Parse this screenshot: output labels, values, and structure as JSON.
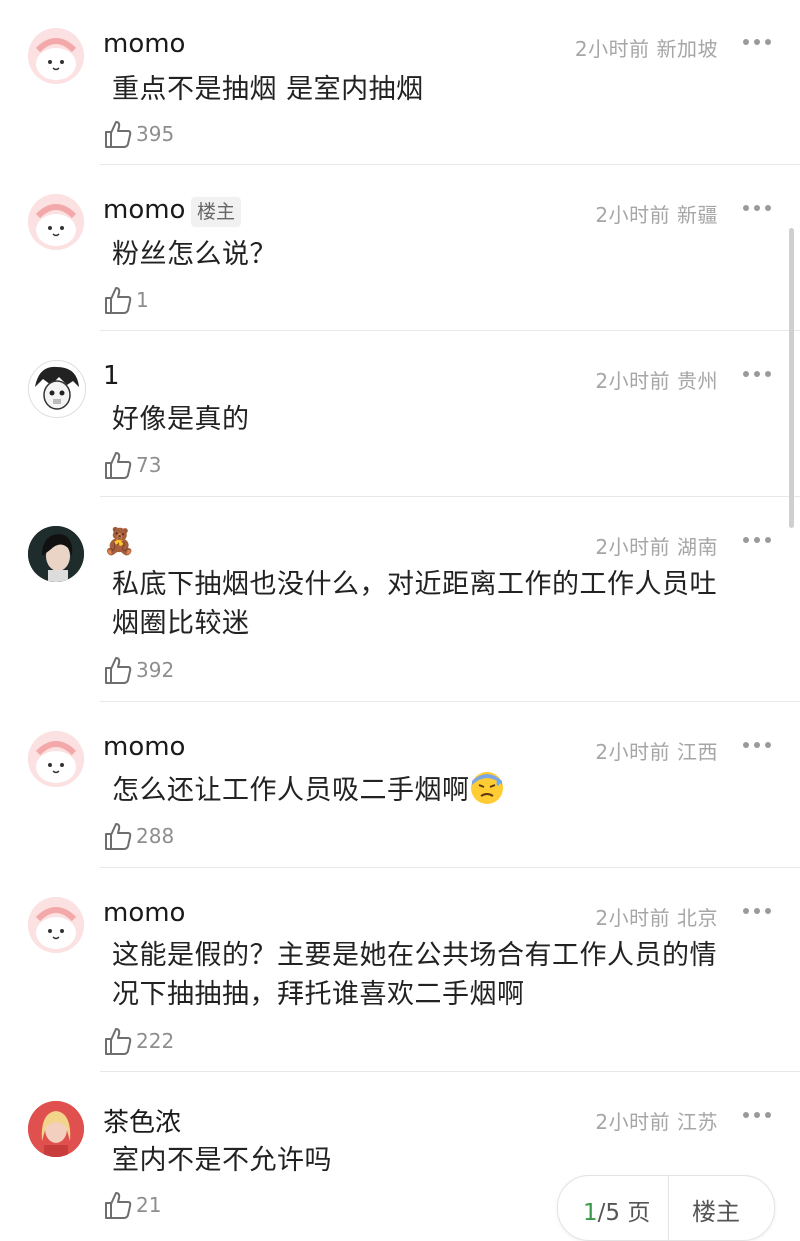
{
  "comments": [
    {
      "name": "momo",
      "badge": "",
      "time": "2小时前",
      "location": "新加坡",
      "lines": [
        "重点不是抽烟 是室内抽烟"
      ],
      "likes": "395",
      "avatar": "pink-character"
    },
    {
      "name": "momo",
      "badge": "楼主",
      "time": "2小时前",
      "location": "新疆",
      "lines": [
        "粉丝怎么说？"
      ],
      "likes": "1",
      "avatar": "pink-character"
    },
    {
      "name": "1",
      "badge": "",
      "time": "2小时前",
      "location": "贵州",
      "lines": [
        "好像是真的"
      ],
      "likes": "73",
      "avatar": "sketch-character"
    },
    {
      "name": "🧸",
      "badge": "",
      "time": "2小时前",
      "location": "湖南",
      "lines": [
        "私底下抽烟也没什么，对近距离工作的工作人员吐",
        "烟圈比较迷"
      ],
      "likes": "392",
      "avatar": "photo-portrait"
    },
    {
      "name": "momo",
      "badge": "",
      "time": "2小时前",
      "location": "江西",
      "lines": [
        "怎么还让工作人员吸二手烟啊"
      ],
      "likes": "288",
      "avatar": "pink-character",
      "emoji": "sweat-face"
    },
    {
      "name": "momo",
      "badge": "",
      "time": "2小时前",
      "location": "北京",
      "lines": [
        "这能是假的？主要是她在公共场合有工作人员的情",
        "况下抽抽抽，拜托谁喜欢二手烟啊"
      ],
      "likes": "222",
      "avatar": "pink-character"
    },
    {
      "name": "茶色浓",
      "badge": "",
      "time": "2小时前",
      "location": "江苏",
      "lines": [
        "室内不是不允许吗"
      ],
      "likes": "21",
      "avatar": "photo-portrait-red"
    }
  ],
  "pager": {
    "current": "1",
    "total": "/5 页",
    "owner_label": "楼主"
  },
  "icons": {
    "like": "thumbs-up-icon",
    "more": "more-dots-icon"
  }
}
